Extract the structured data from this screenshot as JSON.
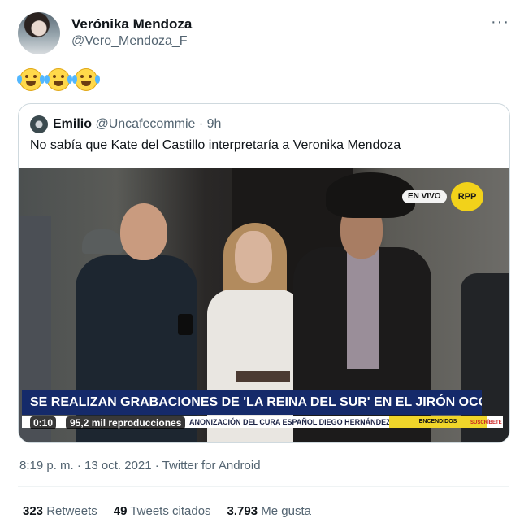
{
  "tweet": {
    "display_name": "Verónika Mendoza",
    "handle": "@Vero_Mendoza_F",
    "more_icon": "more-horizontal-icon",
    "emoji": [
      "face-with-tears-of-joy",
      "face-with-tears-of-joy",
      "face-with-tears-of-joy"
    ],
    "timestamp": "8:19 p. m. · 13 oct. 2021 · Twitter for Android",
    "stats": {
      "retweets_count": "323",
      "retweets_label": "Retweets",
      "quotes_count": "49",
      "quotes_label": "Tweets citados",
      "likes_count": "3.793",
      "likes_label": "Me gusta"
    }
  },
  "quoted_tweet": {
    "display_name": "Emilio",
    "handle": "@Uncafecommie",
    "separator": " · ",
    "age": "9h",
    "text": "No sabía que Kate del Castillo interpretaría a Veronika Mendoza",
    "video": {
      "live_badge": "EN VIVO",
      "logo": "RPP",
      "headline": "SE REALIZAN GRABACIONES DE 'LA REINA DEL SUR' EN EL JIRÓN OCOÑA",
      "ticker_text": "ANONIZACIÓN DEL CURA ESPAÑOL DIEGO HERNÁNDEZ",
      "ticker_tag": "ENCENDIDOS",
      "subscribe_tag": "SUSCRÍBETE",
      "time": "0:10",
      "views": "95,2 mil reproducciones"
    }
  }
}
